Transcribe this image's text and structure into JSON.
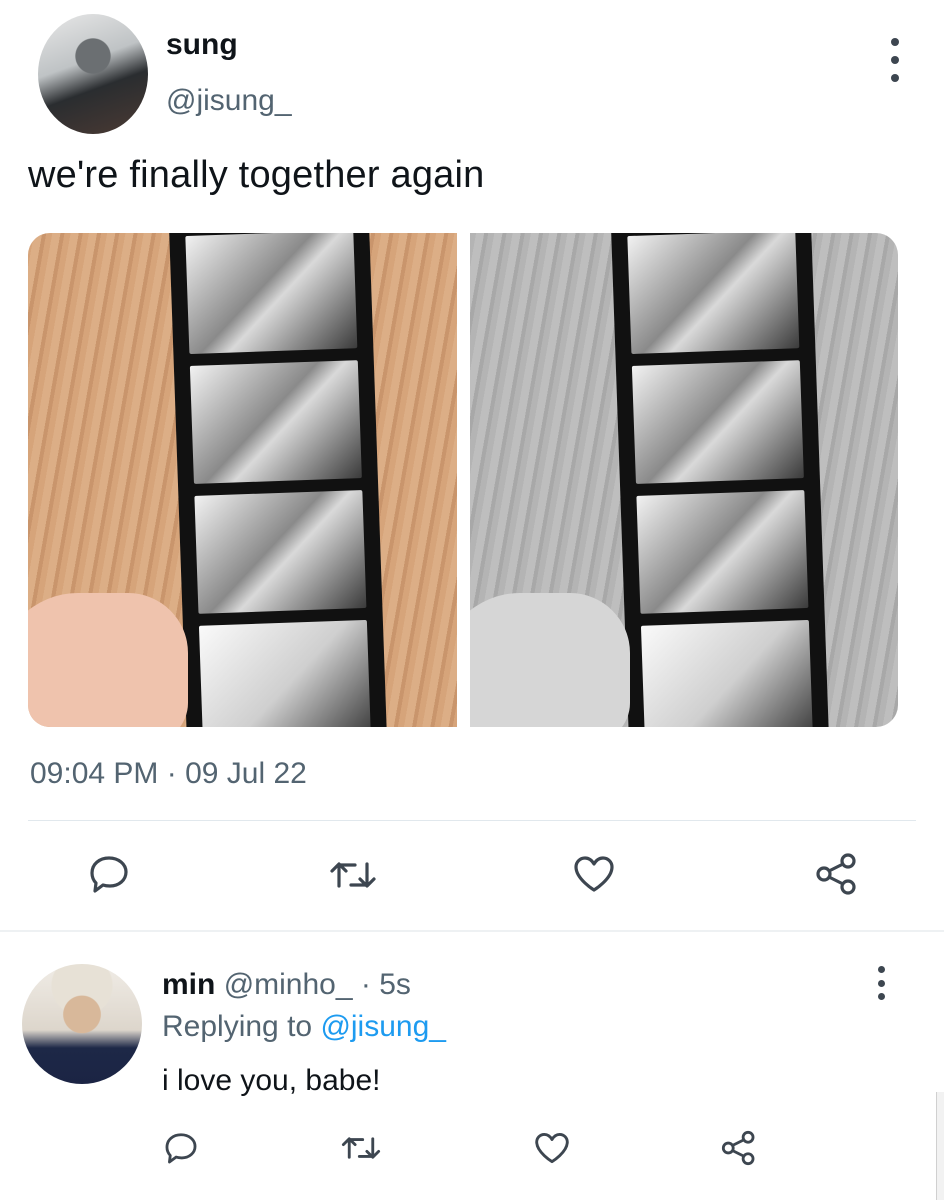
{
  "tweet": {
    "display_name": "sung",
    "handle": "@jisung_",
    "text": "we're finally together again",
    "timestamp": "09:04 PM · 09 Jul 22",
    "icons": [
      "more-vertical-icon",
      "reply-icon",
      "retweet-icon",
      "like-icon",
      "share-icon"
    ]
  },
  "reply": {
    "display_name": "min",
    "handle": "@minho_",
    "time": "· 5s",
    "replying_prefix": "Replying to",
    "replying_to": "@jisung_",
    "text": "i love you, babe!"
  },
  "colors": {
    "text": "#0f1419",
    "secondary": "#536471",
    "accent": "#1d9bf0",
    "divider": "#e1e8ed"
  }
}
